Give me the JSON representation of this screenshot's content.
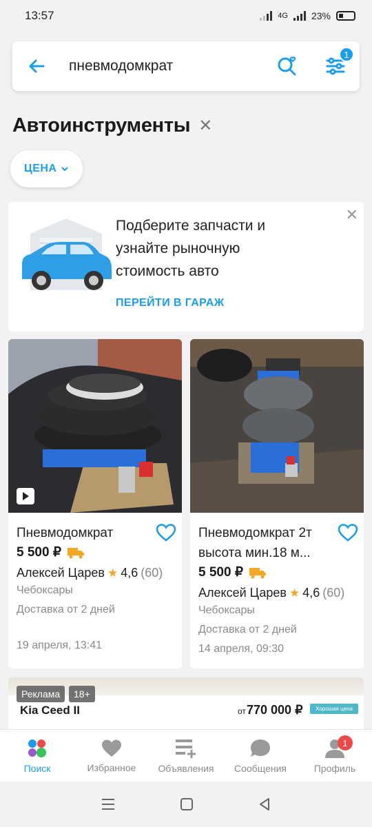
{
  "status_bar": {
    "time": "13:57",
    "network": "4G",
    "battery": "23%"
  },
  "search": {
    "query": "пневмодомкрат",
    "filter_count": "1"
  },
  "category": {
    "title": "Автоинструменты"
  },
  "filters": {
    "price_label": "ЦЕНА"
  },
  "garage_banner": {
    "line1": "Подберите запчасти и",
    "line2": "узнайте рыночную",
    "line3": "стоимость авто",
    "link": "ПЕРЕЙТИ В ГАРАЖ"
  },
  "products": [
    {
      "title": "Пневмодомкрат",
      "price": "5 500 ₽",
      "seller": "Алексей Царев",
      "rating": "4,6",
      "reviews": "(60)",
      "city": "Чебоксары",
      "delivery": "Доставка от 2 дней",
      "date": "19 апреля, 13:41"
    },
    {
      "title_line1": "Пневмодомкрат 2т",
      "title_line2": "высота мин.18 м...",
      "price": "5 500 ₽",
      "seller": "Алексей Царев",
      "rating": "4,6",
      "reviews": "(60)",
      "city": "Чебоксары",
      "delivery": "Доставка от 2 дней",
      "date": "14 апреля, 09:30"
    }
  ],
  "ad": {
    "tag": "Реклама",
    "age": "18+",
    "model": "Kia Ceed II",
    "price_from": "от",
    "price": "770 000 ₽",
    "badge": "Хорошая цена"
  },
  "bottom_nav": {
    "search": "Поиск",
    "favorites": "Избранное",
    "ads": "Объявления",
    "messages": "Сообщения",
    "profile": "Профиль",
    "profile_badge": "1"
  },
  "colors": {
    "accent": "#1a9cf0",
    "badge": "#f04848",
    "star": "#f5a623",
    "truck": "#f5a623"
  }
}
